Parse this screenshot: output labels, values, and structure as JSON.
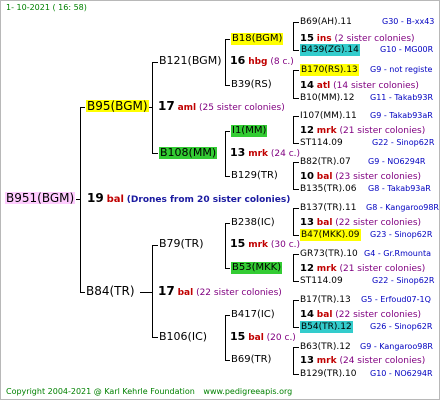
{
  "header": "1- 10-2021 ( 16: 58)",
  "footer": {
    "copyright": "Copyright 2004-2021 @ Karl Kehrle Foundation",
    "site": "www.pedigreeapis.org"
  },
  "colors": {
    "name_bg_yellow": "#ffff00",
    "name_bg_green": "#33cc33",
    "name_bg_cyan": "#33cccc",
    "root_bg": "#ffccff",
    "line": "#000000",
    "footer": "#008000",
    "ref": "#0000c0"
  },
  "root": {
    "name": "B951(BGM)",
    "num": "19",
    "species": "bal",
    "note": "(Drones from 20 sister colonies)"
  },
  "gen1": [
    {
      "name": "B95(BGM)",
      "num": "17",
      "species": "aml",
      "note": "(25 sister colonies)"
    },
    {
      "name": "B84(TR)",
      "num": "17",
      "species": "bal",
      "note": "(22 sister colonies)"
    }
  ],
  "gen2": [
    {
      "name": "B121(BGM)",
      "num": "16",
      "species": "hbg",
      "note": "(8 c.)"
    },
    {
      "name": "B108(MM)",
      "num": "13",
      "species": "mrk",
      "note": "(24 c.)"
    },
    {
      "name": "B79(TR)",
      "num": "15",
      "species": "mrk",
      "note": "(30 c.)"
    },
    {
      "name": "B106(IC)",
      "num": "15",
      "species": "bal",
      "note": "(20 c.)"
    }
  ],
  "gen3": [
    {
      "name": "B18(BGM)"
    },
    {
      "name": "B39(RS)"
    },
    {
      "name": "I1(MM)"
    },
    {
      "name": "B129(TR)"
    },
    {
      "name": "B238(IC)"
    },
    {
      "name": "B53(MKK)"
    },
    {
      "name": "B417(IC)"
    },
    {
      "name": "B69(TR)"
    }
  ],
  "gen3_counts": [
    {
      "num": "15",
      "species": "ins",
      "note": "(2 sister colonies)"
    },
    {
      "num": "14",
      "species": "atl",
      "note": "(14 sister colonies)"
    },
    {
      "num": "12",
      "species": "mrk",
      "note": "(21 sister colonies)"
    },
    {
      "num": "10",
      "species": "bal",
      "note": "(23 sister colonies)"
    },
    {
      "num": "13",
      "species": "bal",
      "note": "(22 sister colonies)"
    },
    {
      "num": "12",
      "species": "mrk",
      "note": "(21 sister colonies)"
    },
    {
      "num": "14",
      "species": "bal",
      "note": "(22 sister colonies)"
    },
    {
      "num": "13",
      "species": "mrk",
      "note": "(24 sister colonies)"
    }
  ],
  "gen4": [
    {
      "name": "B69(AH).11",
      "ref": "G30 - B-xx43"
    },
    {
      "name": "B439(ZG).14",
      "ref": "G10 - MG00R"
    },
    {
      "name": "B170(RS).13",
      "ref": "G9 - not registe"
    },
    {
      "name": "B10(MM).12",
      "ref": "G11 - Takab93R"
    },
    {
      "name": "I107(MM).11",
      "ref": "G9 - Takab93aR"
    },
    {
      "name": "ST114.09",
      "ref": "G22 - Sinop62R"
    },
    {
      "name": "B82(TR).07",
      "ref": "G9 - NO6294R"
    },
    {
      "name": "B135(TR).06",
      "ref": "G8 - Takab93aR"
    },
    {
      "name": "B137(TR).11",
      "ref": "G8 - Kangaroo98R"
    },
    {
      "name": "B47(MKK).09",
      "ref": "G23 - Sinop62R"
    },
    {
      "name": "GR73(TR).10",
      "ref": "G4 - Gr.Rmounta"
    },
    {
      "name": "ST114.09",
      "ref": "G22 - Sinop62R"
    },
    {
      "name": "B17(TR).13",
      "ref": "G5 - Erfoud07-1Q"
    },
    {
      "name": "B54(TR).12",
      "ref": "G26 - Sinop62R"
    },
    {
      "name": "B63(TR).12",
      "ref": "G9 - Kangaroo98R"
    },
    {
      "name": "B129(TR).10",
      "ref": "G10 - NO6294R"
    }
  ]
}
